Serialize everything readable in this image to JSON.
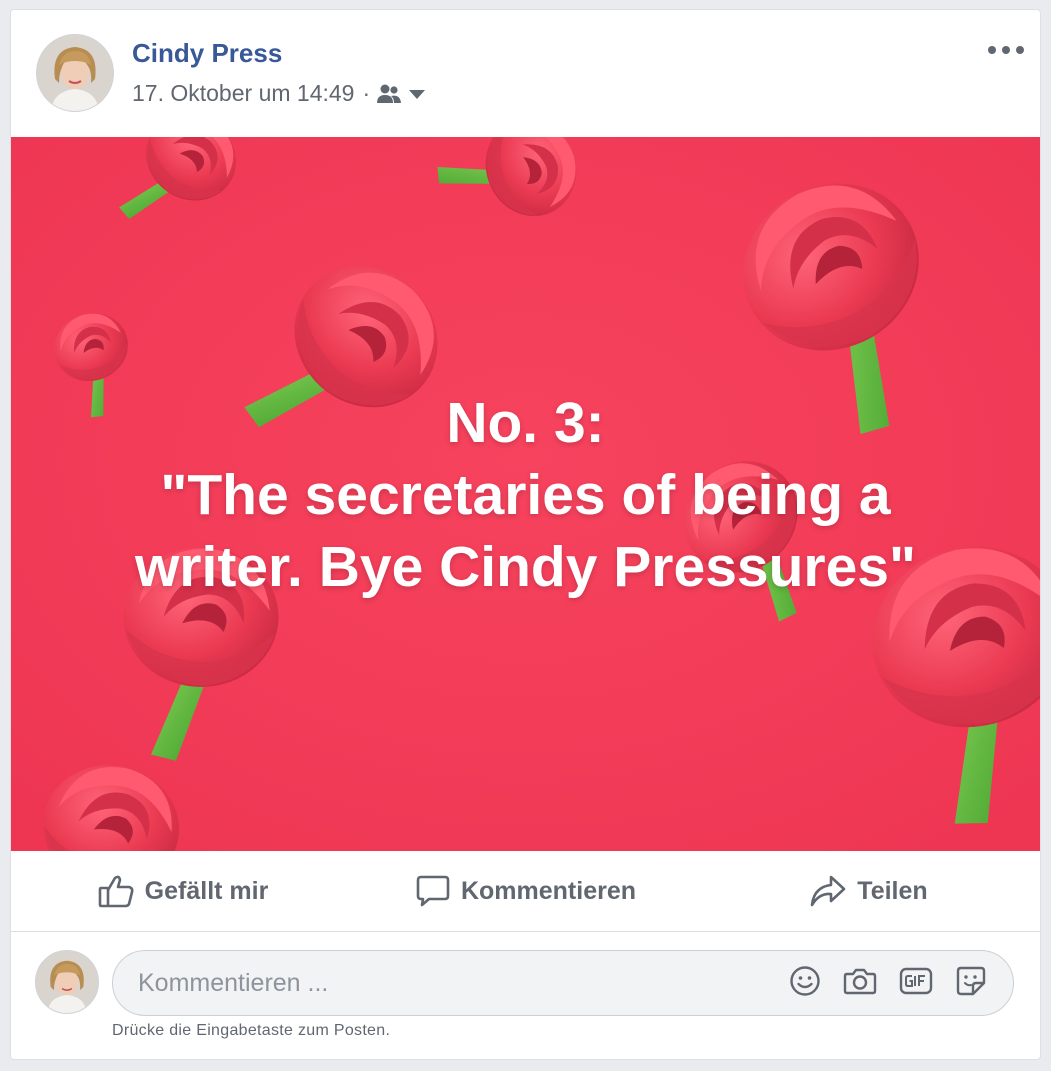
{
  "post": {
    "author": "Cindy Press",
    "timestamp": "17. Oktober um 14:49",
    "separator": "·",
    "audience_icon": "friends-icon",
    "menu_icon": "more-options-icon"
  },
  "media": {
    "background_color": "#f23c59",
    "text_lines": [
      "No. 3:",
      "\"The secretaries of being a",
      "writer. Bye Cindy Pressures\""
    ]
  },
  "actions": {
    "like": {
      "label": "Gefällt mir",
      "icon": "thumbs-up-icon"
    },
    "comment": {
      "label": "Kommentieren",
      "icon": "comment-bubble-icon"
    },
    "share": {
      "label": "Teilen",
      "icon": "share-arrow-icon"
    }
  },
  "composer": {
    "placeholder": "Kommentieren ...",
    "icons": [
      "smiley-icon",
      "camera-icon",
      "gif-icon",
      "sticker-icon"
    ],
    "hint": "Drücke die Eingabetaste zum Posten."
  },
  "colors": {
    "author_link": "#385898",
    "meta_text": "#616770",
    "action_text": "#606770",
    "stem_green": "#5cb63a",
    "rose_red": "#e8374f"
  }
}
